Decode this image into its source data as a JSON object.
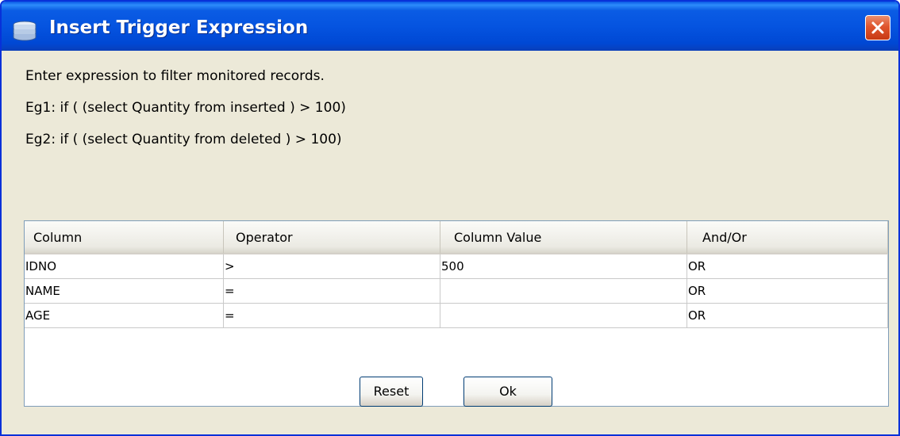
{
  "window": {
    "title": "Insert Trigger Expression"
  },
  "description": {
    "line1": "Enter expression to filter monitored records.",
    "line2": "Eg1: if ( (select Quantity from  inserted ) > 100)",
    "line3": "Eg2: if ( (select Quantity from  deleted ) > 100)"
  },
  "table": {
    "columns": [
      "Column",
      "Operator",
      "Column Value",
      "And/Or"
    ],
    "rows": [
      [
        "IDNO",
        ">",
        "500",
        "OR"
      ],
      [
        "NAME",
        "=",
        "",
        "OR"
      ],
      [
        "AGE",
        "=",
        "",
        "OR"
      ]
    ]
  },
  "buttons": {
    "reset": "Reset",
    "ok": "Ok"
  },
  "colors": {
    "titlebar": "#0554e0",
    "dialog_bg": "#ece9d8",
    "close_button": "#e0552d"
  },
  "icons": {
    "app": "database-icon",
    "close": "close-icon"
  }
}
